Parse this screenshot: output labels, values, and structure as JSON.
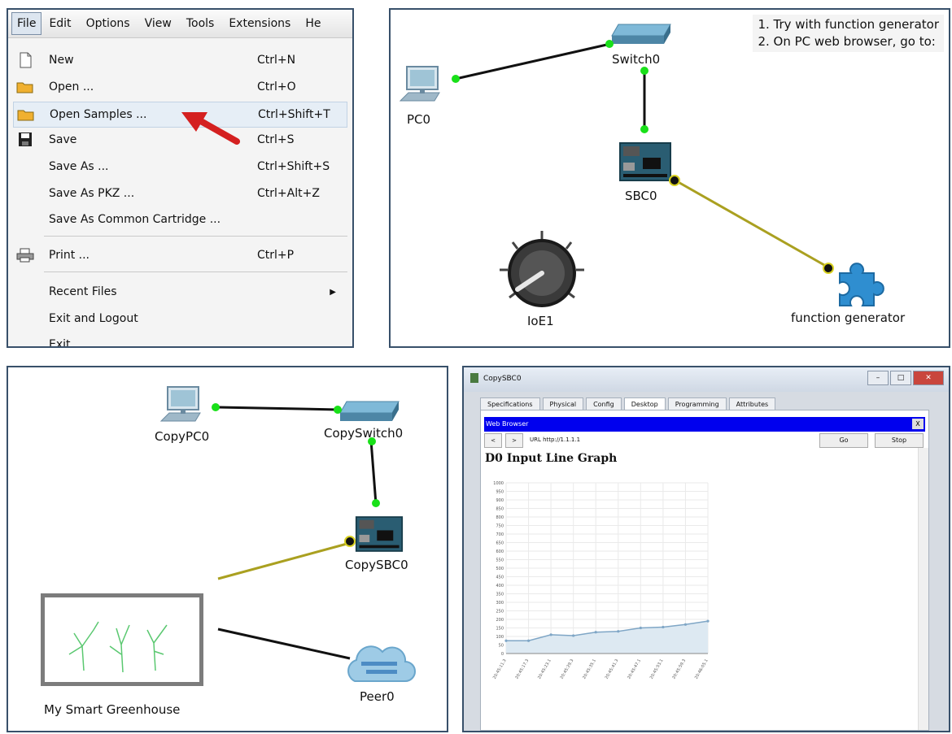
{
  "menu": {
    "bar": [
      "File",
      "Edit",
      "Options",
      "View",
      "Tools",
      "Extensions",
      "He"
    ],
    "items": [
      {
        "label": "New",
        "shortcut": "Ctrl+N"
      },
      {
        "label": "Open ...",
        "shortcut": "Ctrl+O"
      },
      {
        "label": "Open Samples ...",
        "shortcut": "Ctrl+Shift+T"
      },
      {
        "label": "Save",
        "shortcut": "Ctrl+S"
      },
      {
        "label": "Save As ...",
        "shortcut": "Ctrl+Shift+S"
      },
      {
        "label": "Save As PKZ ...",
        "shortcut": "Ctrl+Alt+Z"
      },
      {
        "label": "Save As Common Cartridge ...",
        "shortcut": ""
      },
      {
        "label": "Print ...",
        "shortcut": "Ctrl+P"
      },
      {
        "label": "Recent Files",
        "shortcut": ""
      },
      {
        "label": "Exit and Logout",
        "shortcut": ""
      },
      {
        "label": "Exit",
        "shortcut": ""
      }
    ]
  },
  "topology1": {
    "note_line1": "1. Try with function generator",
    "note_line2": "2. On PC web browser, go to:",
    "pc": "PC0",
    "switch": "Switch0",
    "sbc": "SBC0",
    "ioe": "IoE1",
    "fg": "function generator"
  },
  "topology2": {
    "pc": "CopyPC0",
    "switch": "CopySwitch0",
    "sbc": "CopySBC0",
    "greenhouse": "My Smart Greenhouse",
    "peer": "Peer0"
  },
  "window": {
    "title": "CopySBC0",
    "tabs": [
      "Specifications",
      "Physical",
      "Config",
      "Desktop",
      "Programming",
      "Attributes"
    ],
    "browser_title": "Web Browser",
    "close_label": "X",
    "back": "<",
    "fwd": ">",
    "url": "URL  http://1.1.1.1",
    "go": "Go",
    "stop": "Stop",
    "graph_title": "D0 Input Line Graph"
  },
  "chart_data": {
    "type": "area",
    "title": "D0 Input Line Graph",
    "yticks": [
      "1000",
      "950",
      "900",
      "850",
      "800",
      "750",
      "700",
      "650",
      "600",
      "550",
      "500",
      "450",
      "400",
      "350",
      "300",
      "250",
      "200",
      "150",
      "100",
      "50",
      "0"
    ],
    "ylim": [
      0,
      1000
    ],
    "x": [
      "20:45:11.3",
      "20:45:17.3",
      "20:45:23.1",
      "20:45:29.3",
      "20:45:35.1",
      "20:45:41.3",
      "20:45:47.1",
      "20:45:53.1",
      "20:45:59.3",
      "20:46:05.1"
    ],
    "values": [
      75,
      75,
      110,
      105,
      125,
      130,
      150,
      155,
      170,
      190
    ],
    "grid": true
  }
}
